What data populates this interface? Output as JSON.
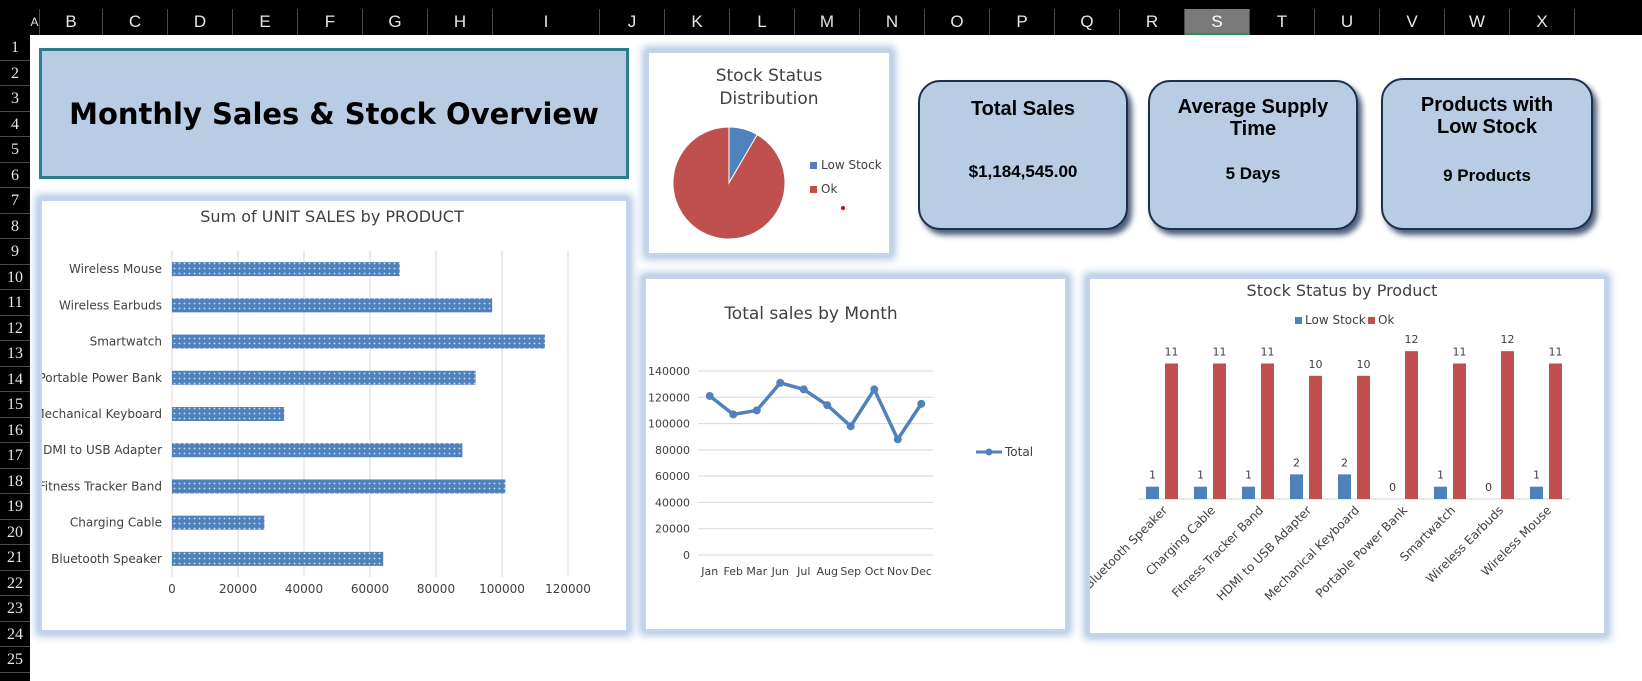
{
  "sheet": {
    "columns": [
      "A",
      "B",
      "C",
      "D",
      "E",
      "F",
      "G",
      "H",
      "I",
      "J",
      "K",
      "L",
      "M",
      "N",
      "O",
      "P",
      "Q",
      "R",
      "S",
      "T",
      "U",
      "V",
      "W",
      "X"
    ],
    "selected_column": "S",
    "rows": [
      "1",
      "2",
      "3",
      "4",
      "5",
      "6",
      "7",
      "8",
      "9",
      "10",
      "11",
      "12",
      "13",
      "14",
      "15",
      "16",
      "17",
      "18",
      "19",
      "20",
      "21",
      "22",
      "23",
      "24",
      "25"
    ]
  },
  "dashboard": {
    "title": "Monthly Sales & Stock Overview"
  },
  "kpis": [
    {
      "label_lines": [
        "Total Sales"
      ],
      "value": "$1,184,545.00"
    },
    {
      "label_lines": [
        "Average Supply",
        "Time"
      ],
      "value": "5 Days"
    },
    {
      "label_lines": [
        "Products with",
        "Low Stock"
      ],
      "value": "9 Products"
    }
  ],
  "colors": {
    "blue": "#4f81bd",
    "red": "#c0504d",
    "kpi_fill": "#b8cce4"
  },
  "chart_data": [
    {
      "type": "pie",
      "title_lines": [
        "Stock Status",
        "Distribution"
      ],
      "categories": [
        "Low Stock",
        "Ok"
      ],
      "values": [
        9,
        98
      ],
      "legend": "right"
    },
    {
      "type": "bar",
      "orientation": "horizontal",
      "title": "Sum of UNIT SALES by PRODUCT",
      "categories": [
        "Bluetooth Speaker",
        "Charging Cable",
        "Fitness Tracker Band",
        "HDMI to USB Adapter",
        "Mechanical Keyboard",
        "Portable Power Bank",
        "Smartwatch",
        "Wireless Earbuds",
        "Wireless Mouse"
      ],
      "values": [
        64000,
        28000,
        101000,
        88000,
        34000,
        92000,
        113000,
        97000,
        69000
      ],
      "xlim": [
        0,
        120000
      ],
      "xticks": [
        "0",
        "20000",
        "40000",
        "60000",
        "80000",
        "100000",
        "120000"
      ],
      "grid": true
    },
    {
      "type": "line",
      "title": "Total sales by Month",
      "categories": [
        "Jan",
        "Feb",
        "Mar",
        "Jun",
        "Jul",
        "Aug",
        "Sep",
        "Oct",
        "Nov",
        "Dec"
      ],
      "series": [
        {
          "name": "Total",
          "values": [
            121000,
            107000,
            110000,
            131000,
            126000,
            114000,
            98000,
            126000,
            88000,
            115000
          ]
        }
      ],
      "ylim": [
        0,
        140000
      ],
      "yticks": [
        "0",
        "20000",
        "40000",
        "60000",
        "80000",
        "100000",
        "120000",
        "140000"
      ],
      "legend": "right",
      "grid": true
    },
    {
      "type": "bar",
      "title": "Stock Status by Product",
      "categories": [
        "Bluetooth Speaker",
        "Charging Cable",
        "Fitness Tracker Band",
        "HDMI to USB Adapter",
        "Mechanical Keyboard",
        "Portable Power Bank",
        "Smartwatch",
        "Wireless Earbuds",
        "Wireless Mouse"
      ],
      "series": [
        {
          "name": "Low Stock",
          "values": [
            1,
            1,
            1,
            2,
            2,
            0,
            1,
            0,
            1
          ]
        },
        {
          "name": "Ok",
          "values": [
            11,
            11,
            11,
            10,
            10,
            12,
            11,
            12,
            11
          ]
        }
      ],
      "ylim": [
        0,
        12.5
      ],
      "legend": "top"
    }
  ]
}
